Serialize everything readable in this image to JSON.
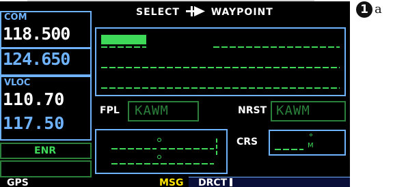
{
  "header": {
    "title": "SELECT",
    "title_suffix": "WAYPOINT",
    "icon": "direct-to-icon"
  },
  "com": {
    "label": "COM",
    "active": "118.500",
    "standby": "124.650"
  },
  "vloc": {
    "label": "VLOC",
    "active": "110.70",
    "standby": "117.50"
  },
  "mode": "ENR",
  "fields": {
    "fpl_label": "FPL",
    "fpl_value": "KAWM",
    "nrst_label": "NRST",
    "nrst_value": "KAWM",
    "crs_label": "CRS"
  },
  "crs_marks": {
    "degree": "°",
    "magnetic": "M"
  },
  "status_bar": {
    "left": "GPS",
    "msg": "MSG",
    "direct": "DRCT"
  },
  "callout": {
    "number": "1",
    "letter": "a"
  },
  "colors": {
    "cyan": "#6fb3ff",
    "green": "#3fd95a",
    "dark_green": "#2a7f3a",
    "white": "#ffffff",
    "yellow": "#ffe400"
  }
}
